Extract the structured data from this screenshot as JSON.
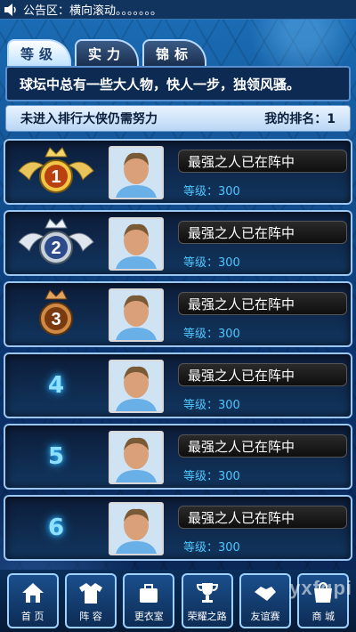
{
  "notice": {
    "text": "公告区：横向滚动。。。。。。。"
  },
  "tabs": [
    {
      "label": "等级",
      "active": true
    },
    {
      "label": "实力",
      "active": false
    },
    {
      "label": "锦标",
      "active": false
    }
  ],
  "message": "球坛中总有一些大人物，快人一步，独领风骚。",
  "rank_header": {
    "left": "未进入排行大侠仍需努力",
    "right": "我的排名：1"
  },
  "rows": [
    {
      "rank": "1",
      "name": "最强之人已在阵中",
      "level": "等级：300"
    },
    {
      "rank": "2",
      "name": "最强之人已在阵中",
      "level": "等级：300"
    },
    {
      "rank": "3",
      "name": "最强之人已在阵中",
      "level": "等级：300"
    },
    {
      "rank": "4",
      "name": "最强之人已在阵中",
      "level": "等级：300"
    },
    {
      "rank": "5",
      "name": "最强之人已在阵中",
      "level": "等级：300"
    },
    {
      "rank": "6",
      "name": "最强之人已在阵中",
      "level": "等级：300"
    }
  ],
  "nav": [
    {
      "label": "首 页",
      "icon": "home-icon"
    },
    {
      "label": "阵 容",
      "icon": "jersey-icon"
    },
    {
      "label": "更衣室",
      "icon": "locker-icon"
    },
    {
      "label": "荣耀之路",
      "icon": "trophy-icon"
    },
    {
      "label": "友谊赛",
      "icon": "handshake-icon"
    },
    {
      "label": "商 城",
      "icon": "shop-icon"
    }
  ],
  "watermark": "yxfqpi"
}
